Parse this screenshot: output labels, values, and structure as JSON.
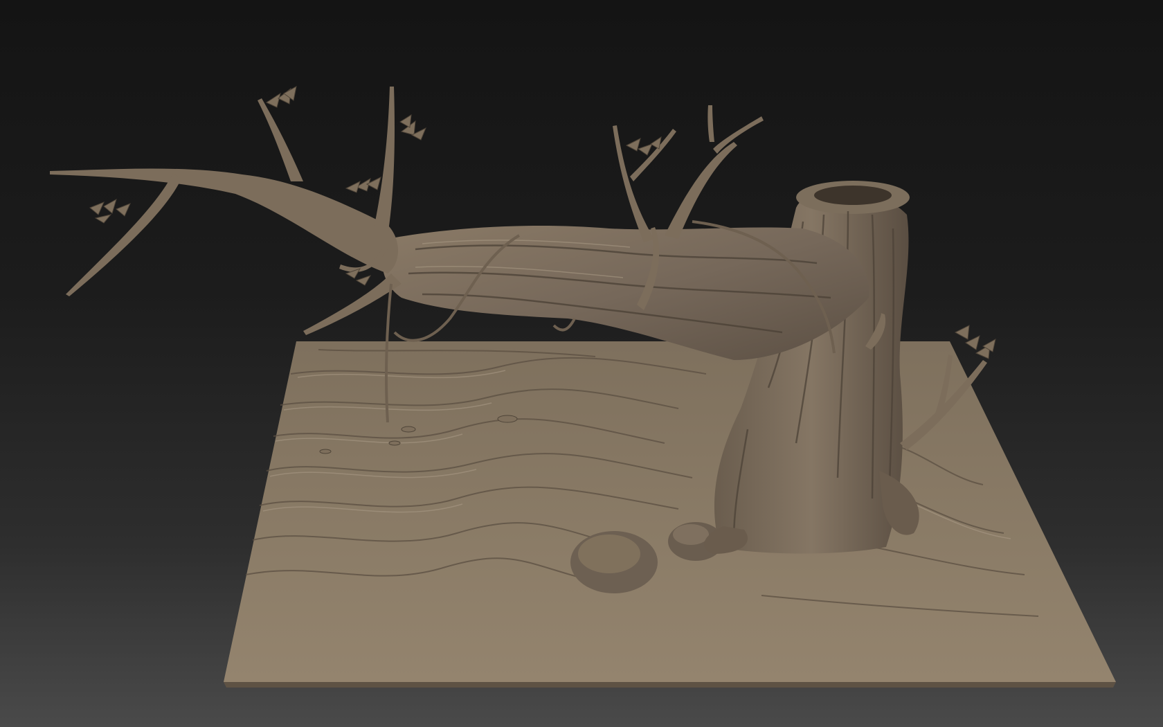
{
  "viewport": {
    "background_top": "#141414",
    "background_bottom": "#4a4a4a"
  },
  "model": {
    "material_color": "#8a7a66",
    "material_shadow": "#4a4034",
    "material_highlight": "#b3a48e",
    "subject_icon": "fallen-tree-stump-on-terrain-sculpt"
  }
}
